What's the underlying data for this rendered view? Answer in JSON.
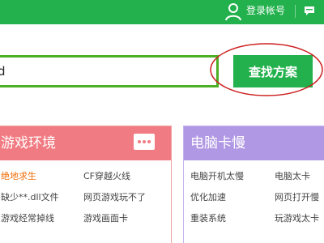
{
  "topbar": {
    "icons": {
      "user": "user-icon",
      "chat": "chat-bubble-icon"
    },
    "login_label": "登录帐号",
    "color": "#22b14c"
  },
  "search": {
    "value": "d",
    "button_label": "查找方案"
  },
  "cards": [
    {
      "title": "游戏环境",
      "header_color": "#f17b82",
      "links": [
        "绝地求生",
        "CF穿越火线",
        "缺少**.dll文件",
        "网页游戏玩不了",
        "游戏经常掉线",
        "游戏画面卡"
      ]
    },
    {
      "title": "电脑卡慢",
      "header_color": "#b198e4",
      "links": [
        "电脑开机太慢",
        "电脑太卡",
        "优化加速",
        "网页打开慢",
        "重装系统",
        "玩游戏太卡"
      ]
    }
  ]
}
